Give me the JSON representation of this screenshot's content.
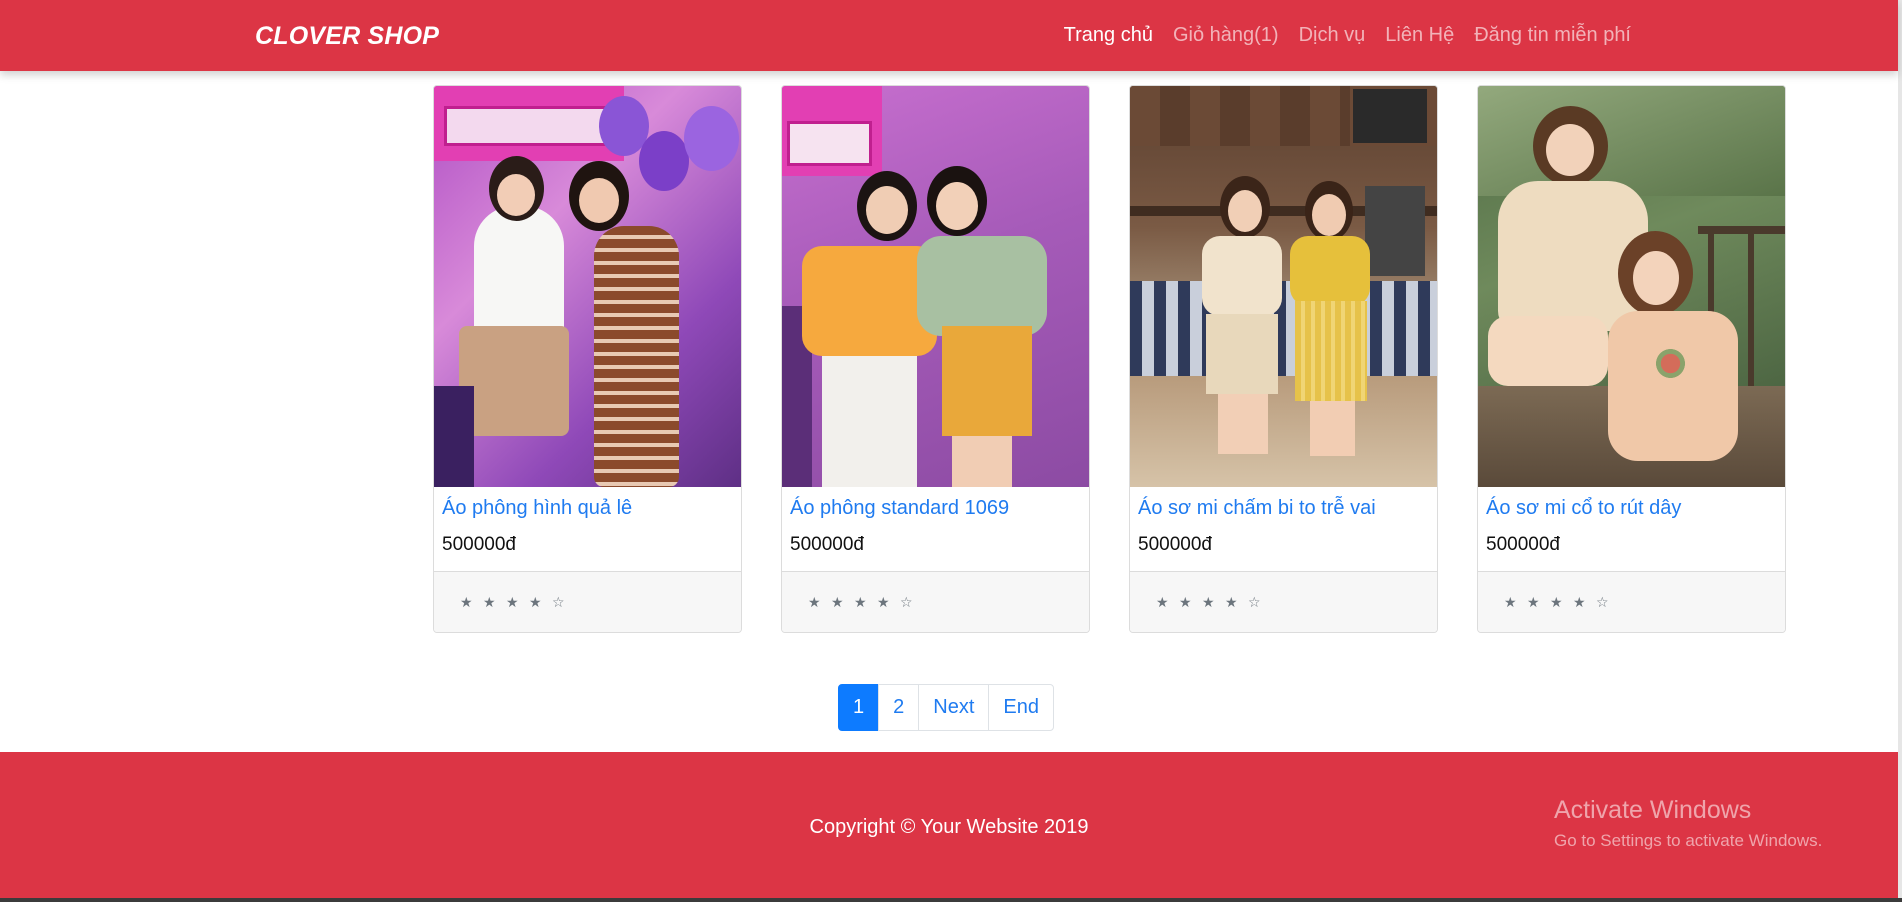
{
  "navbar": {
    "brand": "CLOVER SHOP",
    "links": [
      {
        "label": "Trang chủ",
        "active": true
      },
      {
        "label": "Giỏ hàng(1)",
        "active": false
      },
      {
        "label": "Dịch vụ",
        "active": false
      },
      {
        "label": "Liên Hệ",
        "active": false
      },
      {
        "label": "Đăng tin miễn phí",
        "active": false
      }
    ]
  },
  "products": [
    {
      "title": "Áo phông hình quả lê",
      "price": "500000đ",
      "rating": "★ ★ ★ ★ ☆"
    },
    {
      "title": "Áo phông standard 1069",
      "price": "500000đ",
      "rating": "★ ★ ★ ★ ☆"
    },
    {
      "title": "Áo sơ mi chấm bi to trễ vai",
      "price": "500000đ",
      "rating": "★ ★ ★ ★ ☆"
    },
    {
      "title": "Áo sơ mi cổ to rút dây",
      "price": "500000đ",
      "rating": "★ ★ ★ ★ ☆"
    }
  ],
  "pagination": {
    "pages": [
      {
        "label": "1",
        "active": true
      },
      {
        "label": "2",
        "active": false
      },
      {
        "label": "Next",
        "active": false
      },
      {
        "label": "End",
        "active": false
      }
    ]
  },
  "footer": {
    "copyright": "Copyright © Your Website 2019"
  },
  "watermark": {
    "title": "Activate Windows",
    "subtitle": "Go to Settings to activate Windows."
  },
  "colors": {
    "brand_red": "#dc3545",
    "link_blue": "#1f7bf0",
    "active_page": "#0d7bff"
  }
}
